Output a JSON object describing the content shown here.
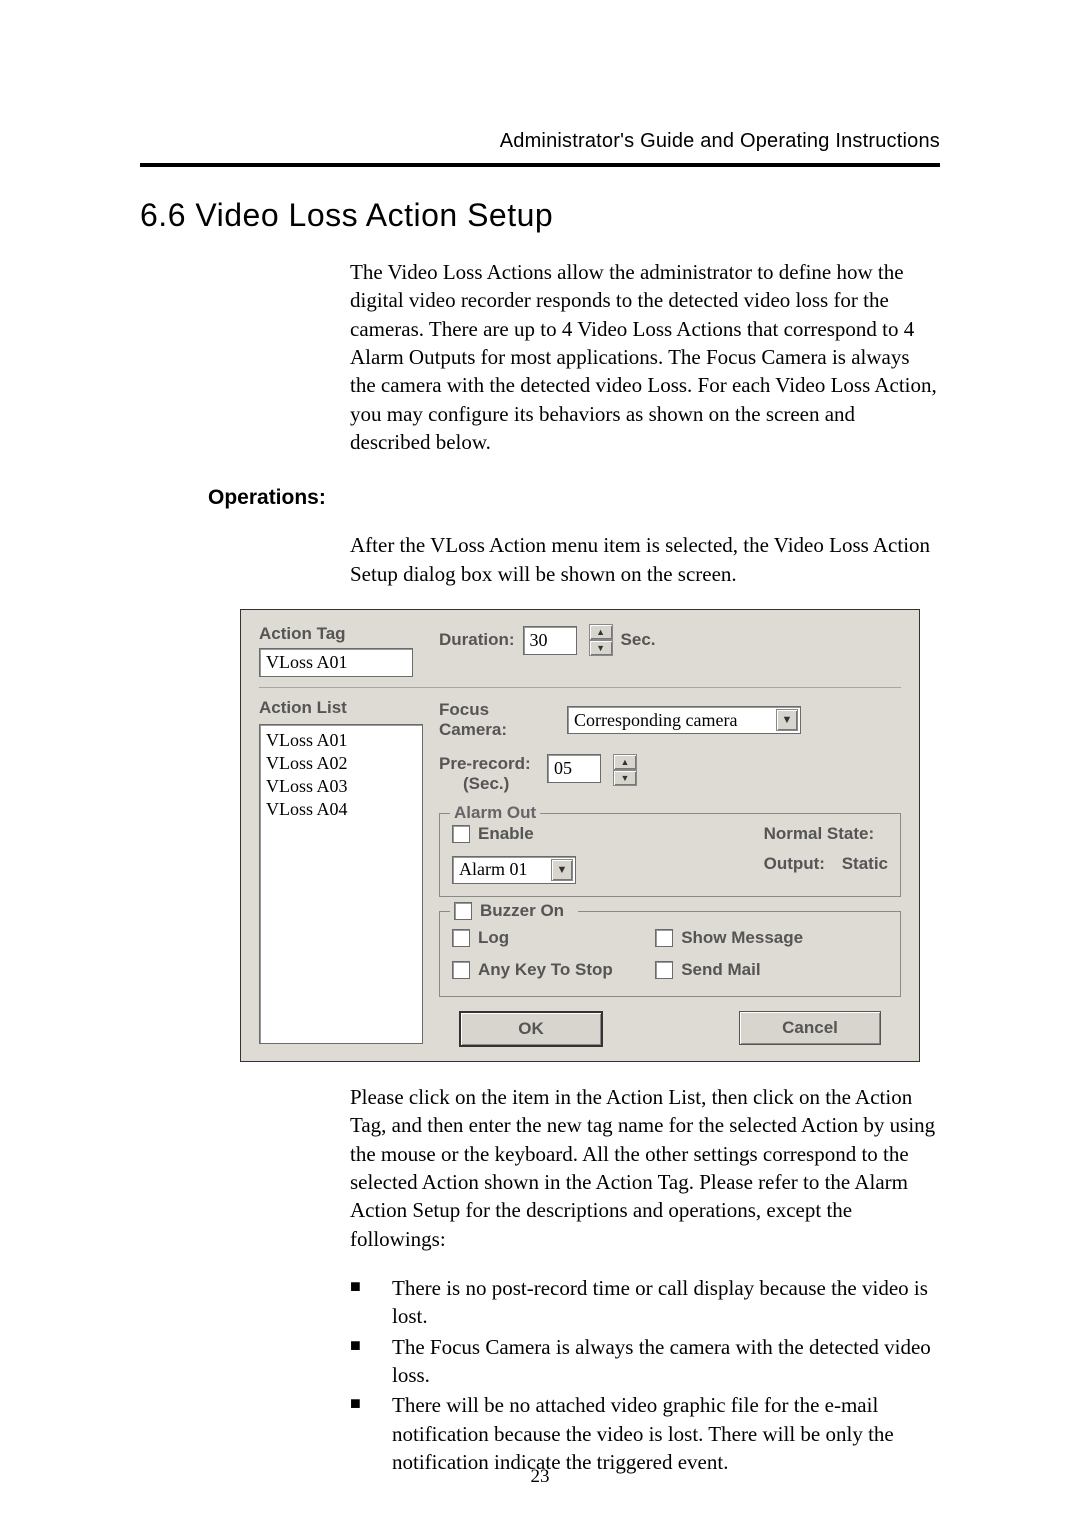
{
  "header": {
    "running_head": "Administrator's Guide and Operating Instructions"
  },
  "section": {
    "title": "6.6 Video Loss Action Setup"
  },
  "para1": "The Video Loss Actions allow the administrator to define how the digital video recorder responds to the detected video loss for the cameras.    There are up to 4 Video Loss Actions that correspond to 4 Alarm Outputs for most applications.    The Focus Camera is always the camera with the detected video Loss.    For each Video Loss Action, you may configure its behaviors as shown on the screen and described below.",
  "ops": {
    "heading": "Operations:"
  },
  "para2": "After the VLoss Action menu item is selected, the Video Loss Action Setup dialog box will be shown on the screen.",
  "dialog": {
    "action_tag_label": "Action Tag",
    "action_tag_value": "VLoss A01",
    "action_list_label": "Action List",
    "action_list_items": [
      "VLoss A01",
      "VLoss A02",
      "VLoss A03",
      "VLoss A04"
    ],
    "duration_label": "Duration:",
    "duration_value": "30",
    "sec_label": "Sec.",
    "focus_camera_label": "Focus Camera:",
    "focus_camera_value": "Corresponding camera",
    "pre_record_label": "Pre-record:",
    "pre_record_unit": "(Sec.)",
    "pre_record_value": "05",
    "alarm_out_legend": "Alarm Out",
    "enable_label": "Enable",
    "alarm_select_value": "Alarm 01",
    "normal_state_label": "Normal State:",
    "output_label": "Output:",
    "output_value": "Static",
    "buzzer_label": "Buzzer On",
    "log_label": "Log",
    "anykey_label": "Any Key To Stop",
    "showmsg_label": "Show Message",
    "sendmail_label": "Send Mail",
    "ok_label": "OK",
    "cancel_label": "Cancel"
  },
  "para3": "Please click on the item in the Action List, then click on the Action Tag, and then enter the new tag name for the selected Action by using the mouse or the keyboard.    All the other settings correspond to the selected Action shown in the Action Tag.    Please refer to the Alarm Action Setup for the descriptions and operations, except the followings:",
  "bullets": [
    "There is no post-record time or call display because the video is lost.",
    "The Focus Camera is always the camera with the detected video loss.",
    "There will be no attached video graphic file for the e-mail notification because the video is lost. There will be only the notification indicate the triggered event."
  ],
  "footer": {
    "page_num": "23"
  }
}
